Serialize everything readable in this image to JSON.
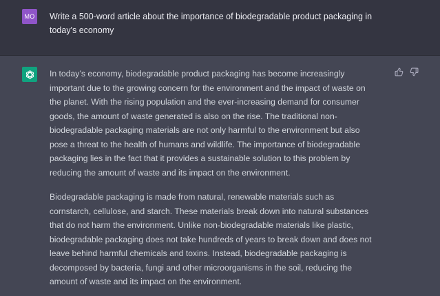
{
  "user_message": {
    "avatar_initials": "MO",
    "text": "Write a 500-word article about the importance of biodegradable product packaging in today's economy"
  },
  "assistant_message": {
    "avatar_icon": "openai-logo-icon",
    "paragraphs": [
      "In today’s economy, biodegradable product packaging has become increasingly important due to the growing concern for the environment and the impact of waste on the planet. With the rising population and the ever-increasing demand for consumer goods, the amount of waste generated is also on the rise. The traditional non-biodegradable packaging materials are not only harmful to the environment but also pose a threat to the health of humans and wildlife. The importance of biodegradable packaging lies in the fact that it provides a sustainable solution to this problem by reducing the amount of waste and its impact on the environment.",
      "Biodegradable packaging is made from natural, renewable materials such as cornstarch, cellulose, and starch. These materials break down into natural substances that do not harm the environment. Unlike non-biodegradable materials like plastic, biodegradable packaging does not take hundreds of years to break down and does not leave behind harmful chemicals and toxins. Instead, biodegradable packaging is decomposed by bacteria, fungi and other microorganisms in the soil, reducing the amount of waste and its impact on the environment."
    ],
    "feedback_icons": [
      "thumbs-up-icon",
      "thumbs-down-icon"
    ]
  },
  "colors": {
    "user_bg": "#343541",
    "assistant_bg": "#444654",
    "user_avatar": "#8f55c8",
    "assistant_avatar": "#10a37f",
    "text": "#d1d5db"
  }
}
